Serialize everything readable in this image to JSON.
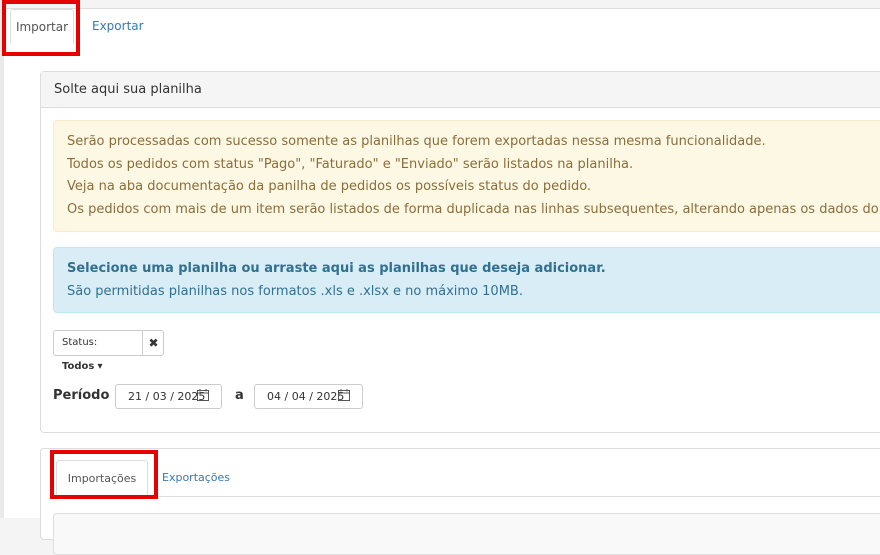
{
  "top_tabs": {
    "import_label": "Importar",
    "export_label": "Exportar"
  },
  "panel": {
    "heading": "Solte aqui sua planilha",
    "warning_lines": [
      "Serão processadas com sucesso somente as planilhas que forem exportadas nessa mesma funcionalidade.",
      "Todos os pedidos com status \"Pago\", \"Faturado\" e \"Enviado\" serão listados na planilha.",
      "Veja na aba documentação da panilha de pedidos os possíveis status do pedido.",
      "Os pedidos com mais de um item serão listados de forma duplicada nas linhas subsequentes, alterando apenas os dados do item."
    ],
    "info_title": "Selecione uma planilha ou arraste aqui as planilhas que deseja adicionar.",
    "info_text": "São permitidas planilhas nos formatos .xls e .xlsx e no máximo 10MB."
  },
  "filters": {
    "status_prefix": "Status:",
    "status_value": "Todos",
    "caret": "▾",
    "clear_symbol": "✖",
    "period_label": "Período",
    "date_from": "21 / 03 / 2025",
    "date_separator": "a",
    "date_to": "04 / 04 / 2025"
  },
  "history_tabs": {
    "imports_label": "Importações",
    "exports_label": "Exportações"
  },
  "colors": {
    "highlight": "#e60000",
    "link": "#337ab7",
    "warning_text": "#8a6d3b",
    "info_text": "#31708f"
  }
}
